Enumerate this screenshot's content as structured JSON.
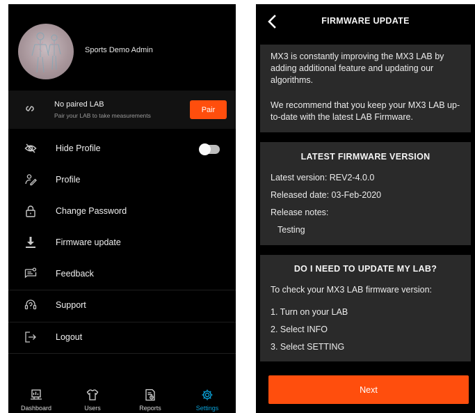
{
  "left_screen": {
    "user": {
      "name": "Sports Demo Admin"
    },
    "lab": {
      "title": "No paired LAB",
      "subtitle": "Pair your LAB to take measurements",
      "pair_button": "Pair",
      "icon": "link-icon"
    },
    "menu": [
      {
        "label": "Hide Profile",
        "icon": "eye-off-icon",
        "toggle": "off"
      },
      {
        "label": "Profile",
        "icon": "user-edit-icon"
      },
      {
        "label": "Change Password",
        "icon": "lock-icon"
      },
      {
        "label": "Firmware update",
        "icon": "download-icon"
      },
      {
        "label": "Feedback",
        "icon": "feedback-icon"
      },
      {
        "label": "Support",
        "icon": "support-icon"
      },
      {
        "label": "Logout",
        "icon": "logout-icon"
      }
    ],
    "bottom_nav": [
      {
        "label": "Dashboard",
        "icon": "dashboard-icon"
      },
      {
        "label": "Users",
        "icon": "users-icon"
      },
      {
        "label": "Reports",
        "icon": "reports-icon"
      },
      {
        "label": "Settings",
        "icon": "gear-icon",
        "active": true
      }
    ]
  },
  "right_screen": {
    "title": "FIRMWARE UPDATE",
    "intro": {
      "p1": "MX3 is constantly improving the MX3 LAB by adding additional feature and updating our algorithms.",
      "p2": "We recommend that you keep your MX3 LAB up-to-date with the latest LAB Firmware."
    },
    "latest": {
      "title": "LATEST FIRMWARE VERSION",
      "version": "Latest version: REV2-4.0.0",
      "released": "Released date: 03-Feb-2020",
      "notes_label": "Release notes:",
      "notes": "Testing"
    },
    "need_update": {
      "title": "DO I NEED TO UPDATE MY LAB?",
      "intro": "To check your MX3 LAB firmware version:",
      "steps": [
        "1. Turn on your LAB",
        "2. Select INFO",
        "3. Select SETTING"
      ]
    },
    "next_button": "Next"
  },
  "colors": {
    "accent": "#ff4e0d",
    "active_nav": "#0aa0d6",
    "background": "#000000",
    "card": "#2a2a2a"
  }
}
